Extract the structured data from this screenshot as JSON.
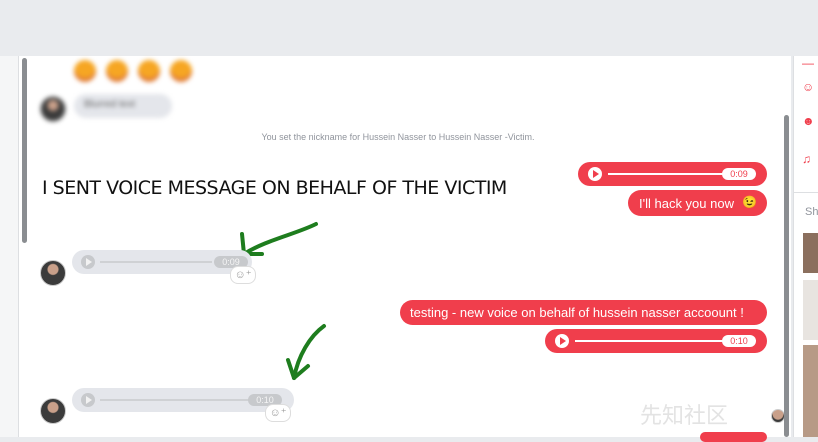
{
  "conversation": {
    "blurred_text": "Blurred text",
    "nickname_notice": "You set the nickname for Hussein Nasser to Hussein Nasser -Victim.",
    "headline": "I SENT VOICE MESSAGE ON BEHALF OF THE VICTIM",
    "outgoing": [
      {
        "type": "voice",
        "duration": "0:09"
      },
      {
        "type": "text",
        "text": "I'll hack you now",
        "emoji": "😉"
      },
      {
        "type": "text",
        "text": "testing  - new voice  on behalf of hussein nasser accoount !"
      },
      {
        "type": "voice",
        "duration": "0:10"
      }
    ],
    "incoming": [
      {
        "type": "voice",
        "duration": "0:09"
      },
      {
        "type": "voice",
        "duration": "0:10"
      }
    ],
    "react_icon": "☺⁺"
  },
  "right_panel": {
    "label": "Sh",
    "icons": [
      "emoji-icon",
      "smiley-icon",
      "bell-icon"
    ]
  },
  "watermark": "先知社区",
  "colors": {
    "brand_red": "#f03e4c",
    "arrow_green": "#1e7d1e",
    "bubble_gray": "#e4e6eb"
  }
}
